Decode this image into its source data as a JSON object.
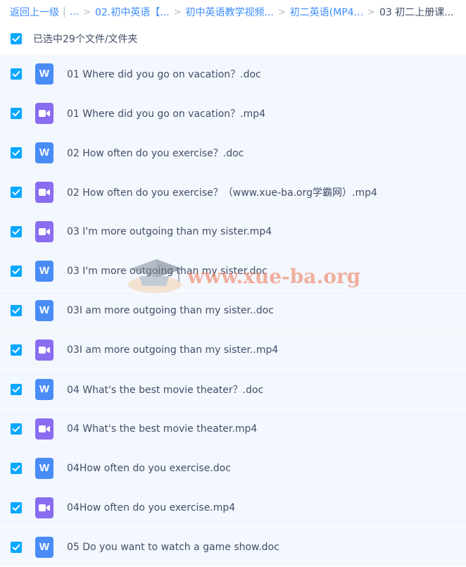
{
  "breadcrumb": {
    "back_label": "返回上一级",
    "ellipsis": "...",
    "items": [
      "02.初中英语【...",
      "初中英语教学视频...",
      "初二英语(MP4...",
      "03 初二上册课..."
    ]
  },
  "selection": {
    "text": "已选中29个文件/文件夹"
  },
  "files": [
    {
      "name": "01 Where did you go on vacation？.doc",
      "type": "doc"
    },
    {
      "name": "01 Where did you go on vacation？.mp4",
      "type": "video"
    },
    {
      "name": "02 How often do you exercise？.doc",
      "type": "doc"
    },
    {
      "name": "02 How often do you exercise？（www.xue-ba.org学霸网）.mp4",
      "type": "video"
    },
    {
      "name": "03 I'm more outgoing than my sister.mp4",
      "type": "video"
    },
    {
      "name": "03 I'm more outgoing than my sister.doc",
      "type": "doc"
    },
    {
      "name": "03I am more outgoing than my sister..doc",
      "type": "doc"
    },
    {
      "name": "03I am more outgoing than my sister..mp4",
      "type": "video"
    },
    {
      "name": "04 What's the best movie theater？.doc",
      "type": "doc"
    },
    {
      "name": "04 What's the best movie theater.mp4",
      "type": "video"
    },
    {
      "name": "04How often do you exercise.doc",
      "type": "doc"
    },
    {
      "name": "04How often do you exercise.mp4",
      "type": "video"
    },
    {
      "name": "05 Do you want to watch a game show.doc",
      "type": "doc"
    }
  ],
  "icons": {
    "doc_letter": "W"
  },
  "watermark": {
    "text": "www.xue-ba.org"
  },
  "colors": {
    "accent": "#06a7ff",
    "link": "#3b8cff",
    "row_bg": "#f3f7fe",
    "doc_icon": "#4a8cf6",
    "video_icon": "#8a6cf0"
  }
}
